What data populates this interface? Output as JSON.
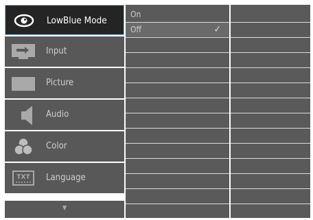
{
  "menu": {
    "items": [
      {
        "label": "LowBlue Mode",
        "icon": "eye-icon",
        "active": true
      },
      {
        "label": "Input",
        "icon": "input-icon"
      },
      {
        "label": "Picture",
        "icon": "picture-icon"
      },
      {
        "label": "Audio",
        "icon": "speaker-icon"
      },
      {
        "label": "Color",
        "icon": "color-icon"
      },
      {
        "label": "Language",
        "icon": "language-icon",
        "icon_text": "TXT"
      }
    ],
    "more_glyph": "▼"
  },
  "options": [
    {
      "label": "On",
      "selected": false
    },
    {
      "label": "Off",
      "selected": true,
      "check": "✓"
    }
  ],
  "colors": {
    "accent_border": "#8fbddc",
    "active_bg": "#242424",
    "panel_bg": "#585858"
  }
}
